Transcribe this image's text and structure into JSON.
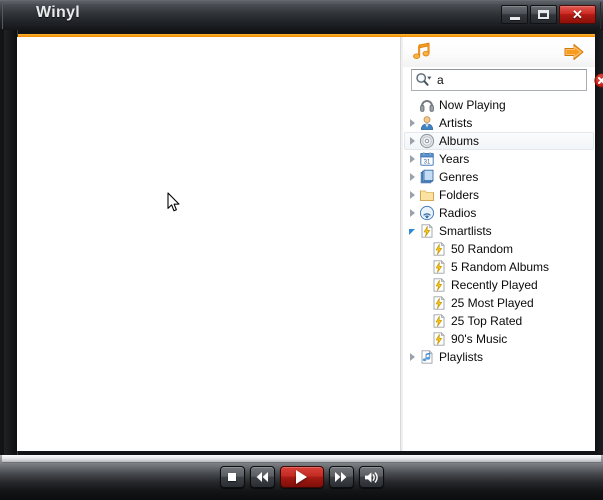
{
  "window": {
    "title": "Winyl",
    "controls": [
      {
        "name": "minimize",
        "label": "Minimize"
      },
      {
        "name": "maximize",
        "label": "Maximize"
      },
      {
        "name": "close",
        "label": "Close",
        "glyph": "✕",
        "color": "#c22a22"
      }
    ]
  },
  "theme": {
    "accent": "#f08a00",
    "titlebar_bg": "#2a2d31",
    "panel_bg": "#ffffff",
    "selection_bg": "#f2f5f8",
    "play_button": "#c22a22"
  },
  "library": {
    "toolbar": {
      "music_icon": "music-note-icon",
      "forward_icon": "arrow-right-icon"
    },
    "search": {
      "value": "a",
      "placeholder": "",
      "search_icon": "search-magnifier-icon",
      "clear_icon": "clear-x-icon"
    },
    "tree": [
      {
        "label": "Now Playing",
        "icon": "headphones-icon",
        "twisty": "none",
        "depth": 0,
        "state": "normal"
      },
      {
        "label": "Artists",
        "icon": "artist-icon",
        "twisty": "closed",
        "depth": 0,
        "state": "normal"
      },
      {
        "label": "Albums",
        "icon": "album-cd-icon",
        "twisty": "closed",
        "depth": 0,
        "state": "hover"
      },
      {
        "label": "Years",
        "icon": "calendar-icon",
        "twisty": "closed",
        "depth": 0,
        "state": "normal"
      },
      {
        "label": "Genres",
        "icon": "genre-books-icon",
        "twisty": "closed",
        "depth": 0,
        "state": "normal"
      },
      {
        "label": "Folders",
        "icon": "folder-icon",
        "twisty": "closed",
        "depth": 0,
        "state": "normal"
      },
      {
        "label": "Radios",
        "icon": "radio-icon",
        "twisty": "closed",
        "depth": 0,
        "state": "normal"
      },
      {
        "label": "Smartlists",
        "icon": "smartlist-icon",
        "twisty": "open",
        "depth": 0,
        "state": "normal"
      },
      {
        "label": "50 Random",
        "icon": "smartlist-icon",
        "twisty": "none",
        "depth": 1,
        "state": "normal"
      },
      {
        "label": "5 Random Albums",
        "icon": "smartlist-icon",
        "twisty": "none",
        "depth": 1,
        "state": "normal"
      },
      {
        "label": "Recently Played",
        "icon": "smartlist-icon",
        "twisty": "none",
        "depth": 1,
        "state": "normal"
      },
      {
        "label": "25 Most Played",
        "icon": "smartlist-icon",
        "twisty": "none",
        "depth": 1,
        "state": "normal"
      },
      {
        "label": "25 Top Rated",
        "icon": "smartlist-icon",
        "twisty": "none",
        "depth": 1,
        "state": "normal"
      },
      {
        "label": "90's Music",
        "icon": "smartlist-icon",
        "twisty": "none",
        "depth": 1,
        "state": "normal"
      },
      {
        "label": "Playlists",
        "icon": "playlist-icon",
        "twisty": "closed",
        "depth": 0,
        "state": "normal"
      }
    ]
  },
  "player": {
    "buttons": [
      {
        "name": "stop",
        "label": "Stop"
      },
      {
        "name": "previous",
        "label": "Previous"
      },
      {
        "name": "play",
        "label": "Play"
      },
      {
        "name": "next",
        "label": "Next"
      },
      {
        "name": "volume",
        "label": "Volume"
      }
    ]
  }
}
